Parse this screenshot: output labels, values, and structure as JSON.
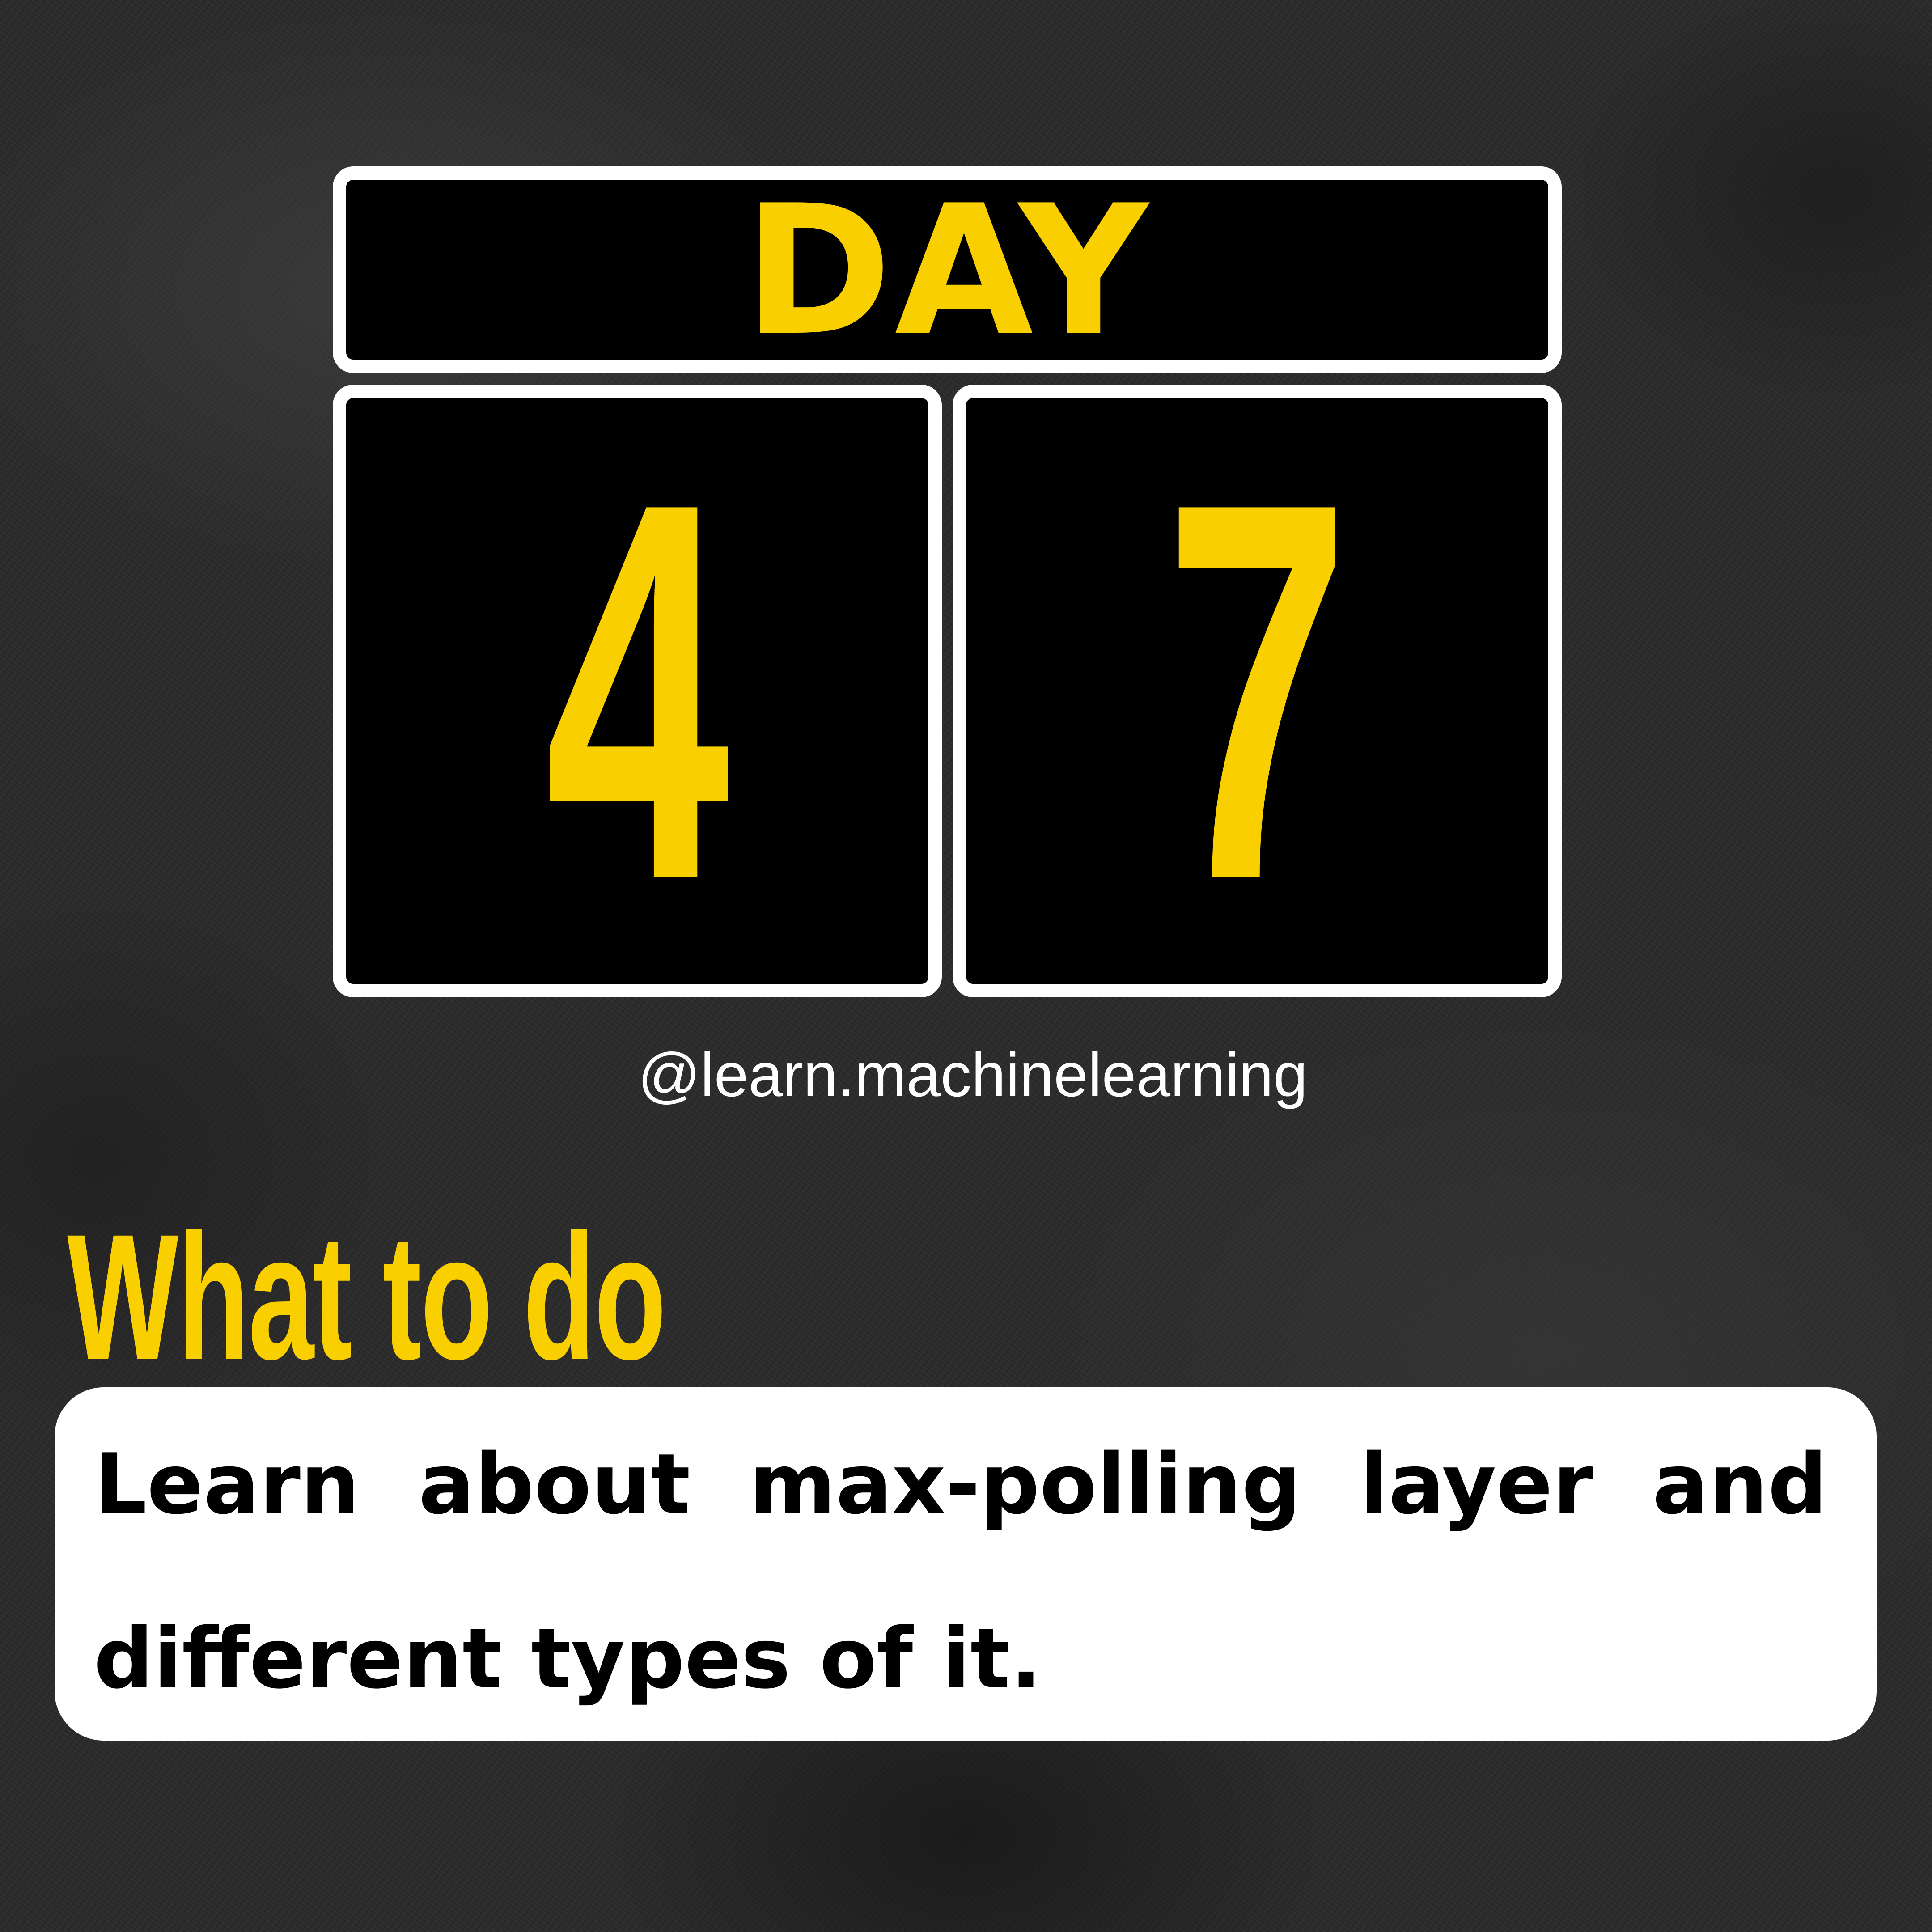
{
  "header": {
    "day_label": "DAY",
    "day_digits": [
      "4",
      "7"
    ]
  },
  "handle": "@learn.machinelearning",
  "section": {
    "heading": "What to do",
    "task": "Learn about max-polling layer and different types of it."
  },
  "colors": {
    "accent_yellow": "#facf00",
    "panel_black": "#000000",
    "panel_border": "#ffffff",
    "background": "#2b2b2b",
    "card_background": "#ffffff",
    "card_text": "#000000"
  }
}
